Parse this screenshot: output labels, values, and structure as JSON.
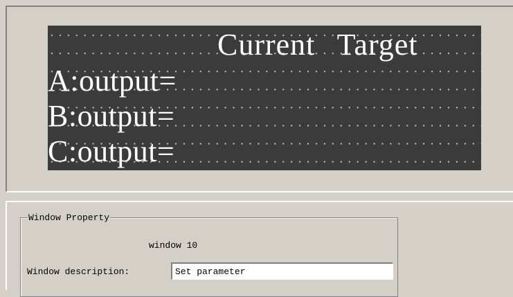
{
  "lcd_preview": {
    "header": "Current Target",
    "rows": [
      {
        "label": "A:output="
      },
      {
        "label": "B:output="
      },
      {
        "label": "C:output="
      }
    ]
  },
  "window_property": {
    "group_title": "Window Property",
    "window_name": "window 10",
    "description_label": "Window description:",
    "description_value": "Set parameter"
  },
  "colors": {
    "panel_bg": "#d4d0c8",
    "lcd_bg": "#3b3b3b",
    "lcd_text": "#ffffff"
  }
}
